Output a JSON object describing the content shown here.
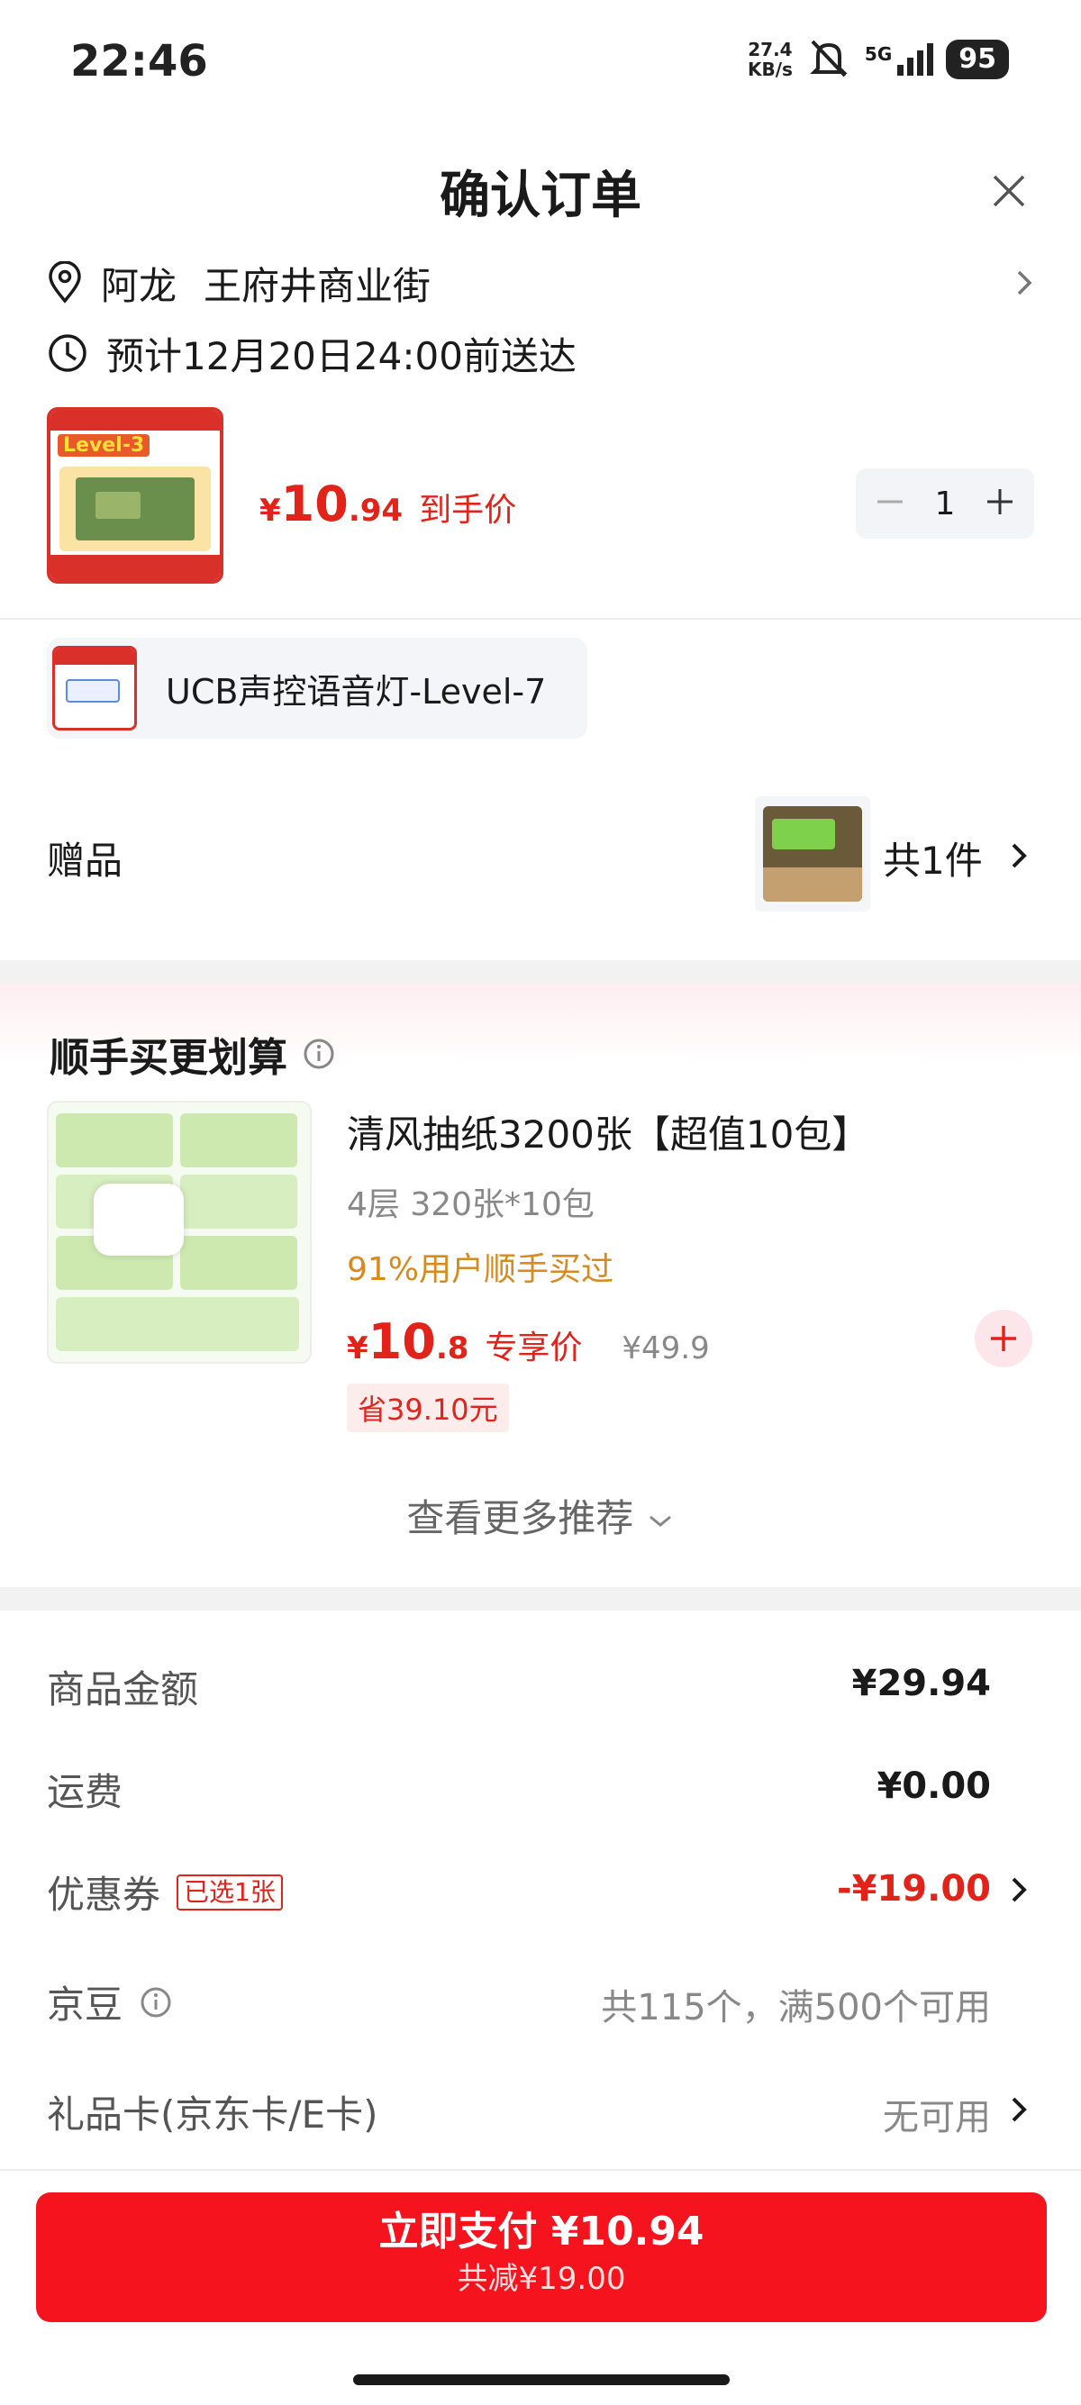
{
  "status_bar": {
    "time": "22:46",
    "net_speed_value": "27.4",
    "net_speed_unit": "KB/s",
    "network": "5G",
    "battery": "95"
  },
  "header": {
    "title": "确认订单"
  },
  "address": {
    "name": "阿龙",
    "street": "王府井商业街"
  },
  "delivery": {
    "text": "预计12月20日24:00前送达"
  },
  "product": {
    "price_symbol": "¥",
    "price_int": "10",
    "price_dec": ".94",
    "price_label": "到手价",
    "quantity": "1",
    "image_badge": "Level-3"
  },
  "accessory": {
    "name": "UCB声控语音灯-Level-7"
  },
  "gift": {
    "label": "赠品",
    "count": "共1件"
  },
  "recommendation": {
    "title": "顺手买更划算",
    "item_name": "清风抽纸3200张【超值10包】",
    "item_spec": "4层 320张*10包",
    "bought_text": "91%用户顺手买过",
    "price_symbol": "¥",
    "price_int": "10",
    "price_dec": ".8",
    "price_label": "专享价",
    "original_price": "¥49.9",
    "save_text": "省39.10元",
    "more_label": "查看更多推荐"
  },
  "summary": {
    "goods_amount_label": "商品金额",
    "goods_amount_value": "¥29.94",
    "shipping_label": "运费",
    "shipping_value": "¥0.00",
    "coupon_label": "优惠券",
    "coupon_tag": "已选1张",
    "coupon_value": "-¥19.00",
    "jingdou_label": "京豆",
    "jingdou_value": "共115个，满500个可用",
    "giftcard_label": "礼品卡(京东卡/E卡)",
    "giftcard_value": "无可用"
  },
  "pay_button": {
    "label": "立即支付 ¥10.94",
    "sub_label": "共减¥19.00"
  },
  "colors": {
    "accent_red": "#e2231a",
    "pay_button": "#f5141e",
    "bought_orange": "#d98a1e"
  }
}
